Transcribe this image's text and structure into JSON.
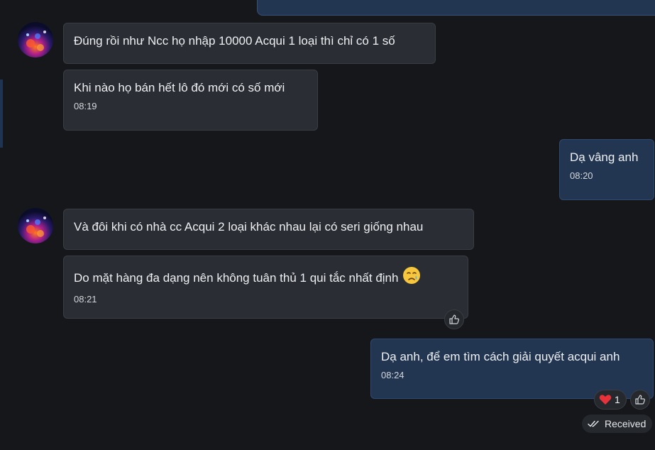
{
  "colors": {
    "background": "#15171b",
    "incoming_bubble": "#2a2d33",
    "outgoing_bubble": "#233651",
    "text": "#eef0f3"
  },
  "messages": [
    {
      "text": "Đúng rồi như Ncc họ nhập 10000 Acqui 1 loại thì chỉ có 1 số",
      "direction": "incoming"
    },
    {
      "text": "Khi nào họ bán hết lô đó mới có số mới",
      "time": "08:19",
      "direction": "incoming"
    },
    {
      "text": "Dạ vâng anh",
      "time": "08:20",
      "direction": "outgoing"
    },
    {
      "text": "Và đôi khi  có nhà cc Acqui 2 loại khác nhau lại có seri giống nhau",
      "direction": "incoming"
    },
    {
      "text": "Do mặt hàng đa dạng nên không tuân thủ 1 qui tắc nhất định",
      "time": "08:21",
      "direction": "incoming",
      "emoji": "crying-face-icon"
    },
    {
      "text": "Dạ anh, để em tìm cách giải quyết acqui anh",
      "time": "08:24",
      "direction": "outgoing"
    }
  ],
  "reactions": {
    "heart_count": "1",
    "heart_icon": "heart-icon",
    "like_icon": "thumbs-up-icon"
  },
  "status": {
    "label": "Received",
    "icon": "double-check-icon"
  }
}
